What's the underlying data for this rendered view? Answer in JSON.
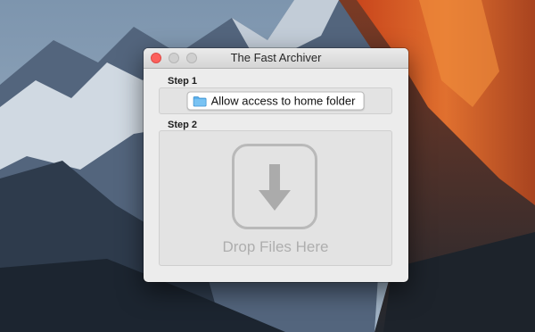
{
  "window": {
    "title": "The Fast Archiver"
  },
  "step1": {
    "label": "Step 1",
    "button_label": "Allow access to home folder",
    "button_icon": "folder-icon"
  },
  "step2": {
    "label": "Step 2",
    "drop_text": "Drop Files Here",
    "drop_icon": "download-arrow-icon"
  },
  "colors": {
    "close_button": "#fc605c",
    "inactive_button": "#cfcfcf",
    "folder_icon": "#5ab0ec",
    "drop_placeholder": "#aeaeae"
  }
}
